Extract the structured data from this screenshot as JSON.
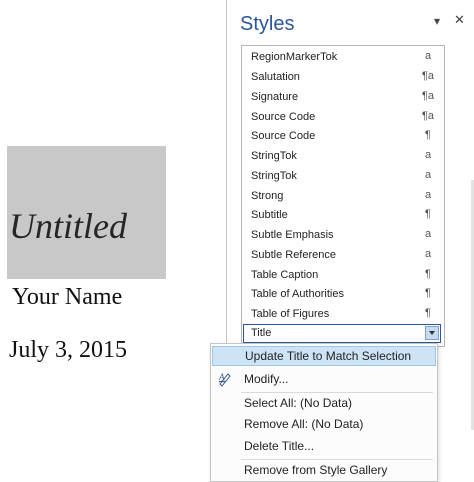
{
  "document": {
    "title": "Untitled",
    "author": "Your Name",
    "date": "July 3, 2015"
  },
  "styles_pane": {
    "title": "Styles",
    "items": [
      {
        "label": "RegionMarkerTok",
        "symbol": "a"
      },
      {
        "label": "Salutation",
        "symbol": "¶a"
      },
      {
        "label": "Signature",
        "symbol": "¶a"
      },
      {
        "label": "Source Code",
        "symbol": "¶a"
      },
      {
        "label": "Source Code",
        "symbol": "¶"
      },
      {
        "label": "StringTok",
        "symbol": "a"
      },
      {
        "label": "StringTok",
        "symbol": "a"
      },
      {
        "label": "Strong",
        "symbol": "a"
      },
      {
        "label": "Subtitle",
        "symbol": "¶"
      },
      {
        "label": "Subtle Emphasis",
        "symbol": "a"
      },
      {
        "label": "Subtle Reference",
        "symbol": "a"
      },
      {
        "label": "Table Caption",
        "symbol": "¶"
      },
      {
        "label": "Table of Authorities",
        "symbol": "¶"
      },
      {
        "label": "Table of Figures",
        "symbol": "¶"
      },
      {
        "label": "Title",
        "symbol": ""
      }
    ],
    "selected_item": "Title"
  },
  "context_menu": {
    "items": [
      {
        "label": "Update Title to Match Selection",
        "highlighted": true
      },
      {
        "label": "Modify...",
        "icon": "modify-style-icon"
      },
      {
        "label": "Select All: (No Data)"
      },
      {
        "label": "Remove All: (No Data)"
      },
      {
        "label": "Delete Title..."
      },
      {
        "label": "Remove from Style Gallery"
      }
    ]
  },
  "colors": {
    "accent": "#2b579a",
    "highlight": "#cde4f7",
    "title_block": "#c8c8c8"
  }
}
